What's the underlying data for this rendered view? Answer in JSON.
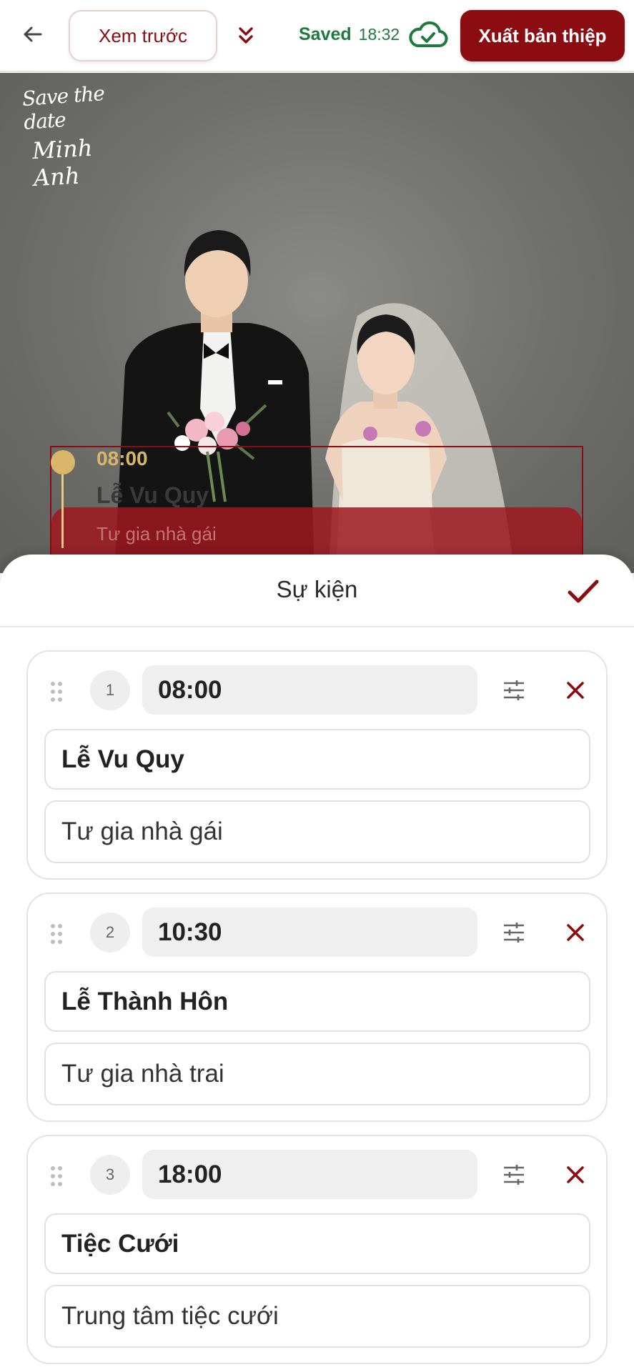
{
  "toolbar": {
    "back_icon": "arrow-left-icon",
    "preview_label": "Xem trước",
    "collapse_icon": "double-chevron-down-icon",
    "saved_label": "Saved",
    "saved_time": "18:32",
    "cloud_icon": "cloud-check-icon",
    "export_label": "Xuất bản thiệp"
  },
  "canvas": {
    "script_line1": "Save the date",
    "script_line2": "Minh Anh",
    "preview_event": {
      "time": "08:00",
      "name": "Lễ Vu Quy",
      "place": "Tư gia nhà gái"
    }
  },
  "sheet": {
    "title": "Sự kiện",
    "confirm_icon": "checkmark-icon",
    "events": [
      {
        "index": "1",
        "time": "08:00",
        "name": "Lễ Vu Quy",
        "place": "Tư gia nhà gái"
      },
      {
        "index": "2",
        "time": "10:30",
        "name": "Lễ Thành Hôn",
        "place": "Tư gia nhà trai"
      },
      {
        "index": "3",
        "time": "18:00",
        "name": "Tiệc Cưới",
        "place": "Trung tâm tiệc cưới"
      }
    ]
  },
  "colors": {
    "accent": "#8b0d12",
    "saved_green": "#1f7a3f",
    "gold": "#d9b66a"
  }
}
